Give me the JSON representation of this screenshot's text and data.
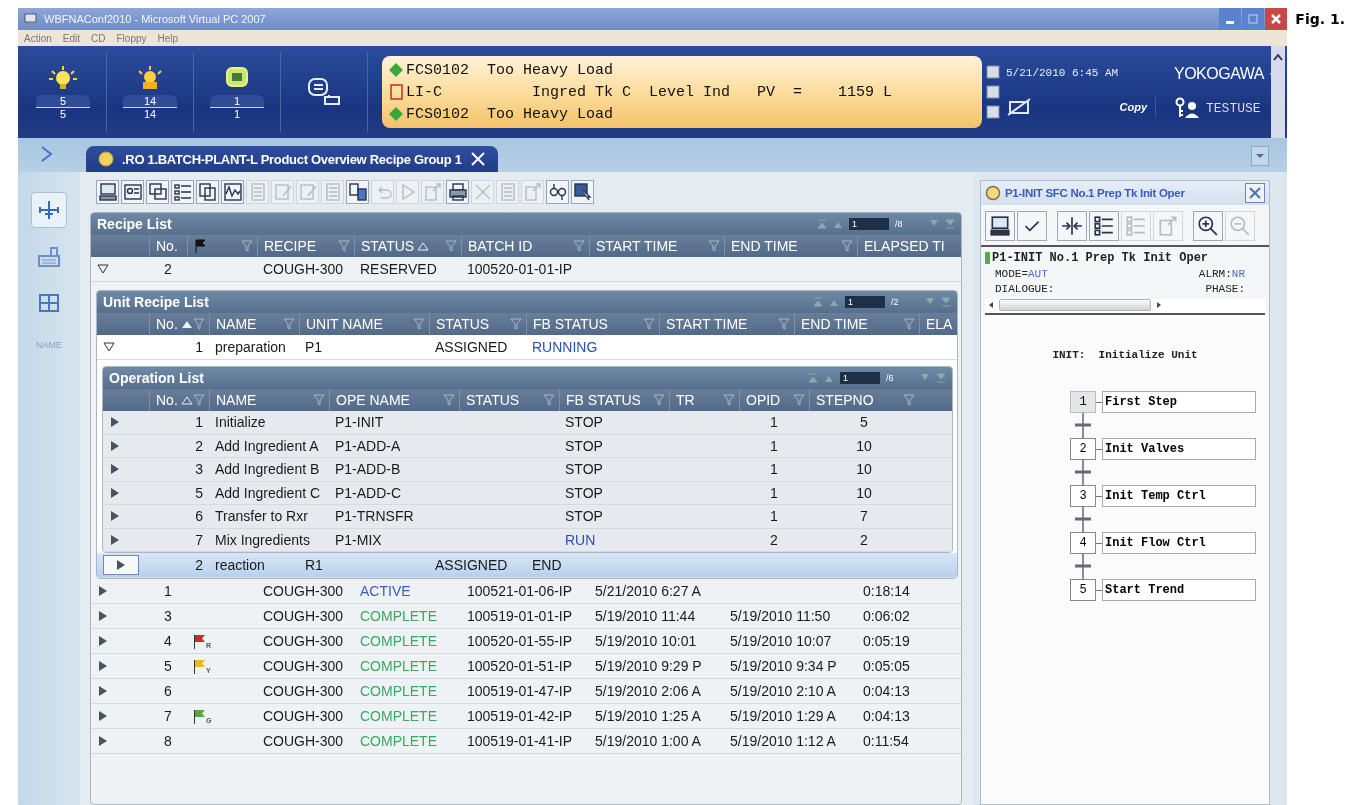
{
  "window": {
    "title": "WBFNAConf2010 - Microsoft Virtual PC 2007",
    "menu": [
      "Action",
      "Edit",
      "CD",
      "Floppy",
      "Help"
    ]
  },
  "figure_label": "Fig. 1.",
  "header": {
    "counters": [
      {
        "kind": "process",
        "count": "5",
        "total": "5"
      },
      {
        "kind": "system",
        "count": "14",
        "total": "14"
      },
      {
        "kind": "guidance",
        "count": "1",
        "total": "1"
      }
    ],
    "alarms": [
      {
        "kind": "diamond",
        "text": "FCS0102  Too Heavy Load"
      },
      {
        "kind": "square",
        "text": "LI-C          Ingred Tk C  Level Ind   PV  =    1159 L"
      },
      {
        "kind": "diamond",
        "text": "FCS0102  Too Heavy Load"
      }
    ],
    "datetime": "5/21/2010 6:45 AM",
    "brand": "YOKOGAWA",
    "copy": "Copy",
    "user": "TESTUSE"
  },
  "tab": {
    "title": ".RO 1.BATCH-PLANT-L Product Overview Recipe Group 1"
  },
  "sidebar": {
    "items": [
      {
        "kind": "tree",
        "selected": true
      },
      {
        "kind": "keyboard",
        "selected": false
      },
      {
        "kind": "grid",
        "selected": false
      }
    ],
    "label": "NAME"
  },
  "toolbar": [
    {
      "kind": "computer",
      "disabled": false
    },
    {
      "kind": "faceplate",
      "disabled": false
    },
    {
      "kind": "window",
      "disabled": false
    },
    {
      "kind": "list",
      "disabled": false
    },
    {
      "kind": "copy",
      "disabled": false
    },
    {
      "kind": "trend",
      "disabled": false
    },
    {
      "kind": "document",
      "disabled": true
    },
    {
      "kind": "edit",
      "disabled": true
    },
    {
      "kind": "edit",
      "disabled": true
    },
    {
      "kind": "document",
      "disabled": true
    },
    {
      "kind": "transfer",
      "disabled": false
    },
    {
      "kind": "undo",
      "disabled": true
    },
    {
      "kind": "play",
      "disabled": true
    },
    {
      "kind": "export",
      "disabled": true
    },
    {
      "kind": "print",
      "disabled": false
    },
    {
      "kind": "delete",
      "disabled": true
    },
    {
      "kind": "document",
      "disabled": true
    },
    {
      "kind": "export",
      "disabled": true
    },
    {
      "kind": "compare",
      "disabled": false
    },
    {
      "kind": "cursor",
      "disabled": false
    }
  ],
  "recipe_list": {
    "title": "Recipe List",
    "page": "1",
    "pages": "/8",
    "columns": [
      {
        "kind": "text",
        "label": "No.",
        "sorted": false
      },
      {
        "kind": "flag",
        "sorted": false
      },
      {
        "kind": "text",
        "label": "RECIPE",
        "sorted": false
      },
      {
        "kind": "text",
        "label": "STATUS",
        "sorted": true
      },
      {
        "kind": "text",
        "label": "BATCH ID",
        "sorted": false
      },
      {
        "kind": "text",
        "label": "START TIME",
        "sorted": false
      },
      {
        "kind": "text",
        "label": "END TIME",
        "sorted": false
      },
      {
        "kind": "text",
        "label": "ELAPSED TI",
        "sorted": false
      }
    ],
    "rows": [
      {
        "no": "2",
        "expanded": true,
        "recipe": "COUGH-300",
        "status": {
          "text": "RESERVED",
          "color": "#1a1a1a"
        },
        "batch_id": "100520-01-01-IP",
        "unit_list": {
          "title": "Unit Recipe List",
          "page": "1",
          "pages": "/2",
          "columns": [
            {
              "label": "No.",
              "sorted": true
            },
            {
              "label": "NAME",
              "sorted": false
            },
            {
              "label": "UNIT NAME",
              "sorted": false
            },
            {
              "label": "STATUS",
              "sorted": false
            },
            {
              "label": "FB STATUS",
              "sorted": false
            },
            {
              "label": "START TIME",
              "sorted": false
            },
            {
              "label": "END TIME",
              "sorted": false
            },
            {
              "label": "ELA",
              "sorted": false
            }
          ],
          "rows": [
            {
              "no": "1",
              "expanded": true,
              "selected": false,
              "name": "preparation",
              "unit": "P1",
              "status": "ASSIGNED",
              "fb_status": {
                "text": "RUNNING",
                "color": "#2a4fb0"
              },
              "operation_list": {
                "title": "Operation List",
                "page": "1",
                "pages": "/6",
                "columns": [
                  {
                    "label": "No.",
                    "sorted": true
                  },
                  {
                    "label": "NAME",
                    "sorted": false
                  },
                  {
                    "label": "OPE NAME",
                    "sorted": false
                  },
                  {
                    "label": "STATUS",
                    "sorted": false
                  },
                  {
                    "label": "FB STATUS",
                    "sorted": false
                  },
                  {
                    "label": "TR",
                    "sorted": false
                  },
                  {
                    "label": "OPID",
                    "sorted": false
                  },
                  {
                    "label": "STEPNO",
                    "sorted": false
                  }
                ],
                "rows": [
                  {
                    "no": "1",
                    "expanded": false,
                    "name": "Initialize",
                    "ope_name": "P1-INIT",
                    "fb_status": {
                      "text": "STOP",
                      "color": "#1a1a1a"
                    },
                    "opid": "1",
                    "stepno": "5"
                  },
                  {
                    "no": "2",
                    "expanded": false,
                    "name": "Add Ingredient A",
                    "ope_name": "P1-ADD-A",
                    "fb_status": {
                      "text": "STOP",
                      "color": "#1a1a1a"
                    },
                    "opid": "1",
                    "stepno": "10"
                  },
                  {
                    "no": "3",
                    "expanded": false,
                    "name": "Add Ingredient B",
                    "ope_name": "P1-ADD-B",
                    "fb_status": {
                      "text": "STOP",
                      "color": "#1a1a1a"
                    },
                    "opid": "1",
                    "stepno": "10"
                  },
                  {
                    "no": "5",
                    "expanded": false,
                    "name": "Add Ingredient C",
                    "ope_name": "P1-ADD-C",
                    "fb_status": {
                      "text": "STOP",
                      "color": "#1a1a1a"
                    },
                    "opid": "1",
                    "stepno": "10"
                  },
                  {
                    "no": "6",
                    "expanded": false,
                    "name": "Transfer to Rxr",
                    "ope_name": "P1-TRNSFR",
                    "fb_status": {
                      "text": "STOP",
                      "color": "#1a1a1a"
                    },
                    "opid": "1",
                    "stepno": "7"
                  },
                  {
                    "no": "7",
                    "expanded": false,
                    "name": "Mix Ingredients",
                    "ope_name": "P1-MIX",
                    "fb_status": {
                      "text": "RUN",
                      "color": "#2a4fb0"
                    },
                    "opid": "2",
                    "stepno": "2"
                  }
                ]
              }
            },
            {
              "no": "2",
              "expanded": false,
              "selected": true,
              "name": "reaction",
              "unit": "R1",
              "status": "ASSIGNED",
              "fb_status": {
                "text": "END",
                "color": "#1a1a1a"
              }
            }
          ]
        }
      },
      {
        "no": "1",
        "expanded": false,
        "recipe": "COUGH-300",
        "status": {
          "text": "ACTIVE",
          "color": "#3a5cc0"
        },
        "batch_id": "100521-01-06-IP",
        "start": "5/21/2010 6:27 A",
        "elapsed": "0:18:14"
      },
      {
        "no": "3",
        "expanded": false,
        "recipe": "COUGH-300",
        "status": {
          "text": "COMPLETE",
          "color": "#3aa860"
        },
        "batch_id": "100519-01-01-IP",
        "start": "5/19/2010 11:44",
        "end": "5/19/2010 11:50",
        "elapsed": "0:06:02"
      },
      {
        "no": "4",
        "expanded": false,
        "flag": {
          "color": "#d02828",
          "letter": "R"
        },
        "recipe": "COUGH-300",
        "status": {
          "text": "COMPLETE",
          "color": "#3aa860"
        },
        "batch_id": "100520-01-55-IP",
        "start": "5/19/2010 10:01",
        "end": "5/19/2010 10:07",
        "elapsed": "0:05:19"
      },
      {
        "no": "5",
        "expanded": false,
        "flag": {
          "color": "#e8b820",
          "letter": "Y"
        },
        "recipe": "COUGH-300",
        "status": {
          "text": "COMPLETE",
          "color": "#3aa860"
        },
        "batch_id": "100520-01-51-IP",
        "start": "5/19/2010 9:29 P",
        "end": "5/19/2010 9:34 P",
        "elapsed": "0:05:05"
      },
      {
        "no": "6",
        "expanded": false,
        "recipe": "COUGH-300",
        "status": {
          "text": "COMPLETE",
          "color": "#3aa860"
        },
        "batch_id": "100519-01-47-IP",
        "start": "5/19/2010 2:06 A",
        "end": "5/19/2010 2:10 A",
        "elapsed": "0:04:13"
      },
      {
        "no": "7",
        "expanded": false,
        "flag": {
          "color": "#58a838",
          "letter": "G"
        },
        "recipe": "COUGH-300",
        "status": {
          "text": "COMPLETE",
          "color": "#3aa860"
        },
        "batch_id": "100519-01-42-IP",
        "start": "5/19/2010 1:25 A",
        "end": "5/19/2010 1:29 A",
        "elapsed": "0:04:13"
      },
      {
        "no": "8",
        "expanded": false,
        "recipe": "COUGH-300",
        "status": {
          "text": "COMPLETE",
          "color": "#3aa860"
        },
        "batch_id": "100519-01-41-IP",
        "start": "5/19/2010 1:00 A",
        "end": "5/19/2010 1:12 A",
        "elapsed": "0:11:54"
      }
    ]
  },
  "sfc": {
    "title": "P1-INIT SFC  No.1 Prep Tk Init Oper",
    "toolbar": [
      {
        "kind": "computer",
        "disabled": false
      },
      {
        "kind": "check",
        "disabled": false
      },
      {
        "kind": "collapse",
        "disabled": false
      },
      {
        "kind": "list",
        "disabled": false
      },
      {
        "kind": "list",
        "disabled": true
      },
      {
        "kind": "export",
        "disabled": true
      },
      {
        "kind": "zoom-in",
        "disabled": false
      },
      {
        "kind": "zoom-out",
        "disabled": true
      }
    ],
    "info": "P1-INIT No.1 Prep Tk Init Oper",
    "mode_label": "MODE=",
    "mode": "AUT",
    "alarm_label": "ALRM:",
    "alarm": "NR",
    "dialogue": "DIALOGUE:",
    "phase": "PHASE:",
    "heading": "INIT:  Initialize Unit",
    "steps": [
      {
        "no": "1",
        "name": "First Step",
        "active": true
      },
      {
        "no": "2",
        "name": "Init Valves",
        "active": false
      },
      {
        "no": "3",
        "name": "Init Temp Ctrl",
        "active": false
      },
      {
        "no": "4",
        "name": "Init Flow Ctrl",
        "active": false
      },
      {
        "no": "5",
        "name": "Start Trend",
        "active": false
      }
    ]
  }
}
